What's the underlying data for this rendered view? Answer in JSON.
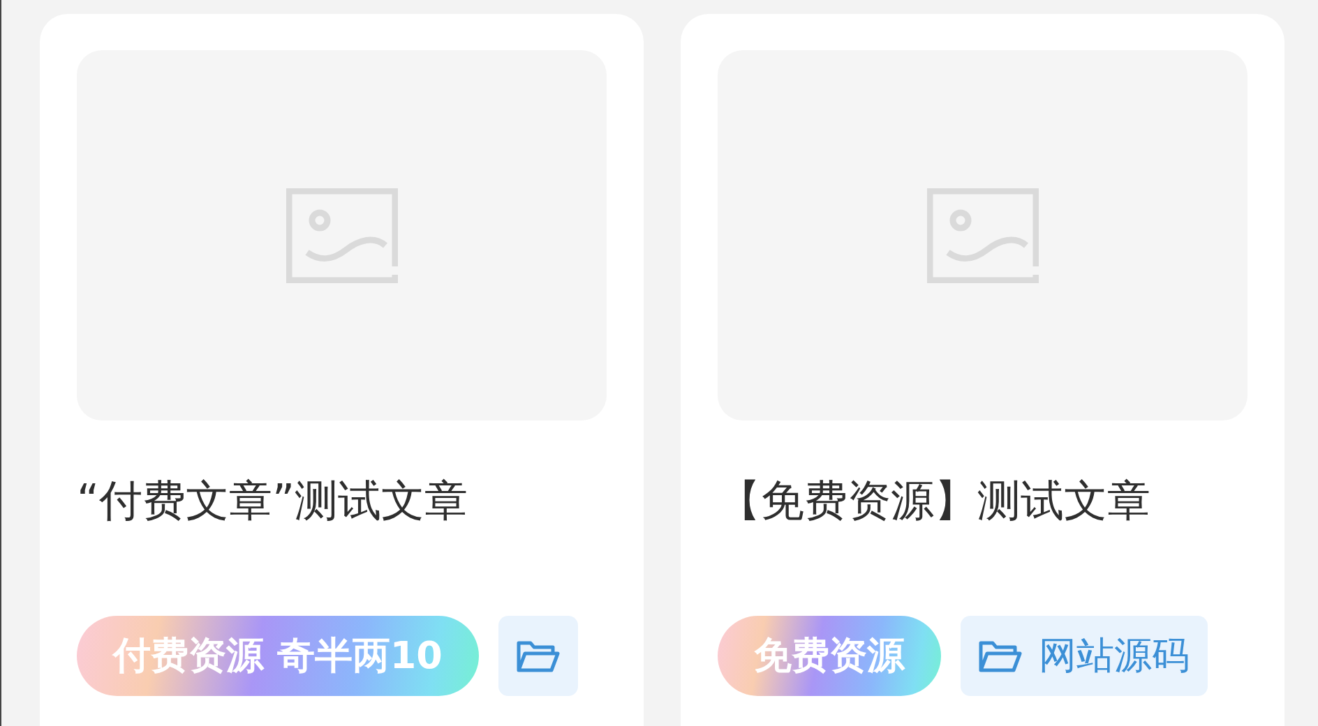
{
  "cards": [
    {
      "image": {
        "kind": "placeholder"
      },
      "title": "“付费文章”测试文章",
      "tags": [
        {
          "kind": "price",
          "label": "付费资源 奇半两10"
        },
        {
          "kind": "category"
        }
      ]
    },
    {
      "image": {
        "kind": "placeholder"
      },
      "title": "【免费资源】测试文章",
      "tags": [
        {
          "kind": "price",
          "label": "免费资源"
        },
        {
          "kind": "category",
          "label": "网站源码"
        }
      ]
    }
  ]
}
